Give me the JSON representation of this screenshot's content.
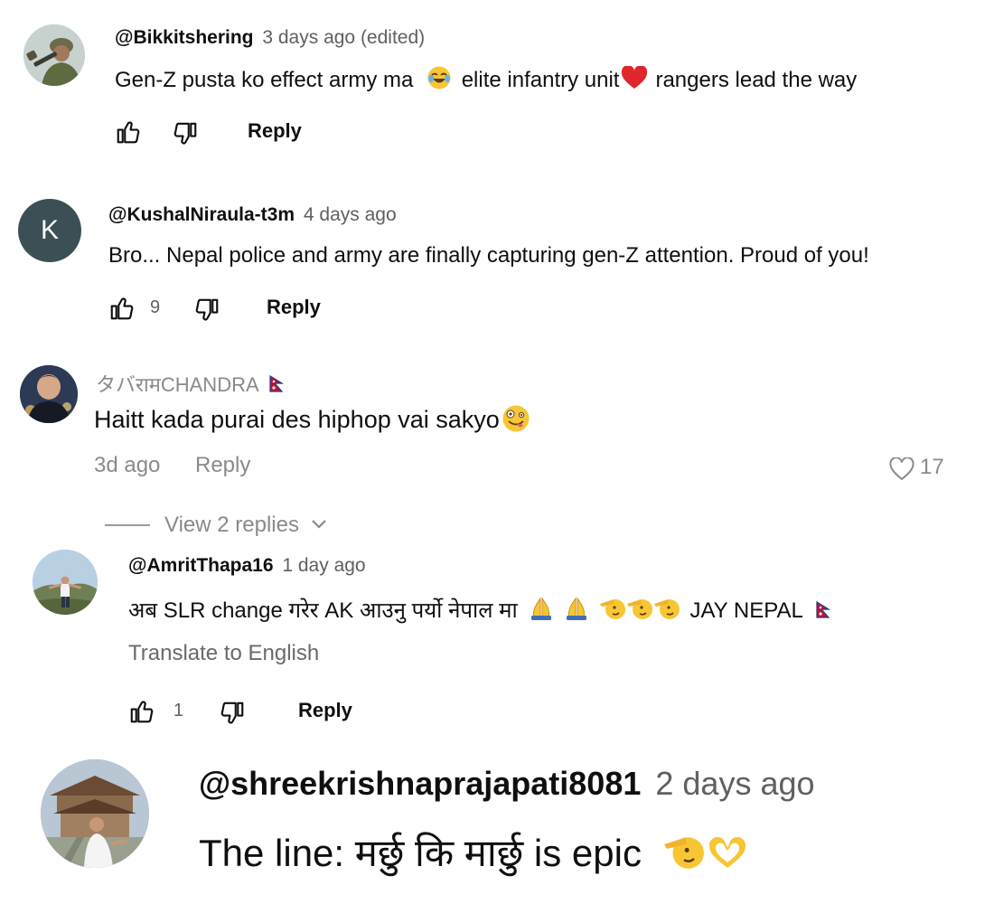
{
  "comments": [
    {
      "author": "@Bikkitshering",
      "time": "3 days ago (edited)",
      "text_a": "Gen-Z pusta  ko effect army ma",
      "text_b": "elite infantry unit",
      "text_c": "rangers lead the way",
      "reply_label": "Reply"
    },
    {
      "author": "@KushalNiraula-t3m",
      "avatar_letter": "K",
      "time": "4 days ago",
      "text": "Bro... Nepal police and army are finally capturing gen-Z attention. Proud of you!",
      "like_count": "9",
      "reply_label": "Reply"
    },
    {
      "author": "タバरामCHANDRA",
      "text": "Haitt kada purai des hiphop vai sakyo",
      "time": "3d ago",
      "reply_label": "Reply",
      "like_count": "17",
      "view_replies": "View 2 replies"
    },
    {
      "author": "@AmritThapa16",
      "time": "1 day ago",
      "text_a": "अब SLR change गरेर AK आउनु पर्यो  नेपाल मा",
      "text_b": "JAY NEPAL",
      "translate": "Translate to English",
      "like_count": "1",
      "reply_label": "Reply"
    },
    {
      "author": "@shreekrishnaprajapati8081",
      "time": "2 days ago",
      "text": "The line: मर्छु कि मार्छु is epic"
    }
  ],
  "colors": {
    "avatar_k": "#3b4f55",
    "nepal_flag": "#c8102e",
    "heart": "#e0262d",
    "muted": "#606060"
  }
}
